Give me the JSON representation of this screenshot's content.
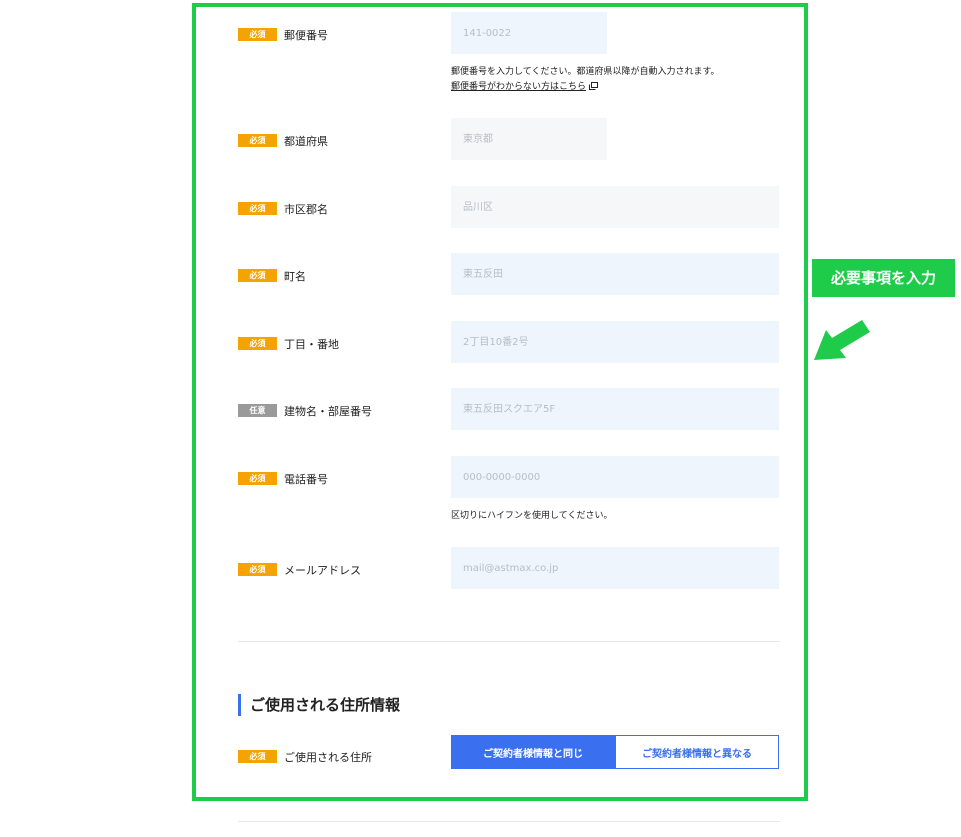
{
  "form": {
    "badges": {
      "required": "必須",
      "optional": "任意"
    },
    "fields": [
      {
        "label": "郵便番号",
        "placeholder": "141-0022",
        "help": "郵便番号を入力してください。都道府県以降が自動入力されます。",
        "link": "郵便番号がわからない方はこちら"
      },
      {
        "label": "都道府県",
        "placeholder": "東京都"
      },
      {
        "label": "市区郡名",
        "placeholder": "品川区"
      },
      {
        "label": "町名",
        "placeholder": "東五反田"
      },
      {
        "label": "丁目・番地",
        "placeholder": "2丁目10番2号"
      },
      {
        "label": "建物名・部屋番号",
        "placeholder": "東五反田スクエア5F"
      },
      {
        "label": "電話番号",
        "placeholder": "000-0000-0000",
        "help": "区切りにハイフンを使用してください。"
      },
      {
        "label": "メールアドレス",
        "placeholder": "mail@astmax.co.jp"
      }
    ]
  },
  "usage_section": {
    "title": "ご使用される住所情報",
    "label": "ご使用される住所",
    "options": [
      "ご契約者様情報と同じ",
      "ご契約者様情報と異なる"
    ],
    "selected": "ご契約者様情報と同じ"
  },
  "annotation": {
    "callout_text": "必要事項を入力",
    "highlight_color": "#1fcc4a"
  },
  "icons": [
    "external-link-icon",
    "pointing-arrow-icon"
  ],
  "colors": {
    "required_badge": "#f5a300",
    "optional_badge": "#9a9a9a",
    "accent_blue": "#3a6ff0",
    "input_bg": "#eff5fc"
  }
}
